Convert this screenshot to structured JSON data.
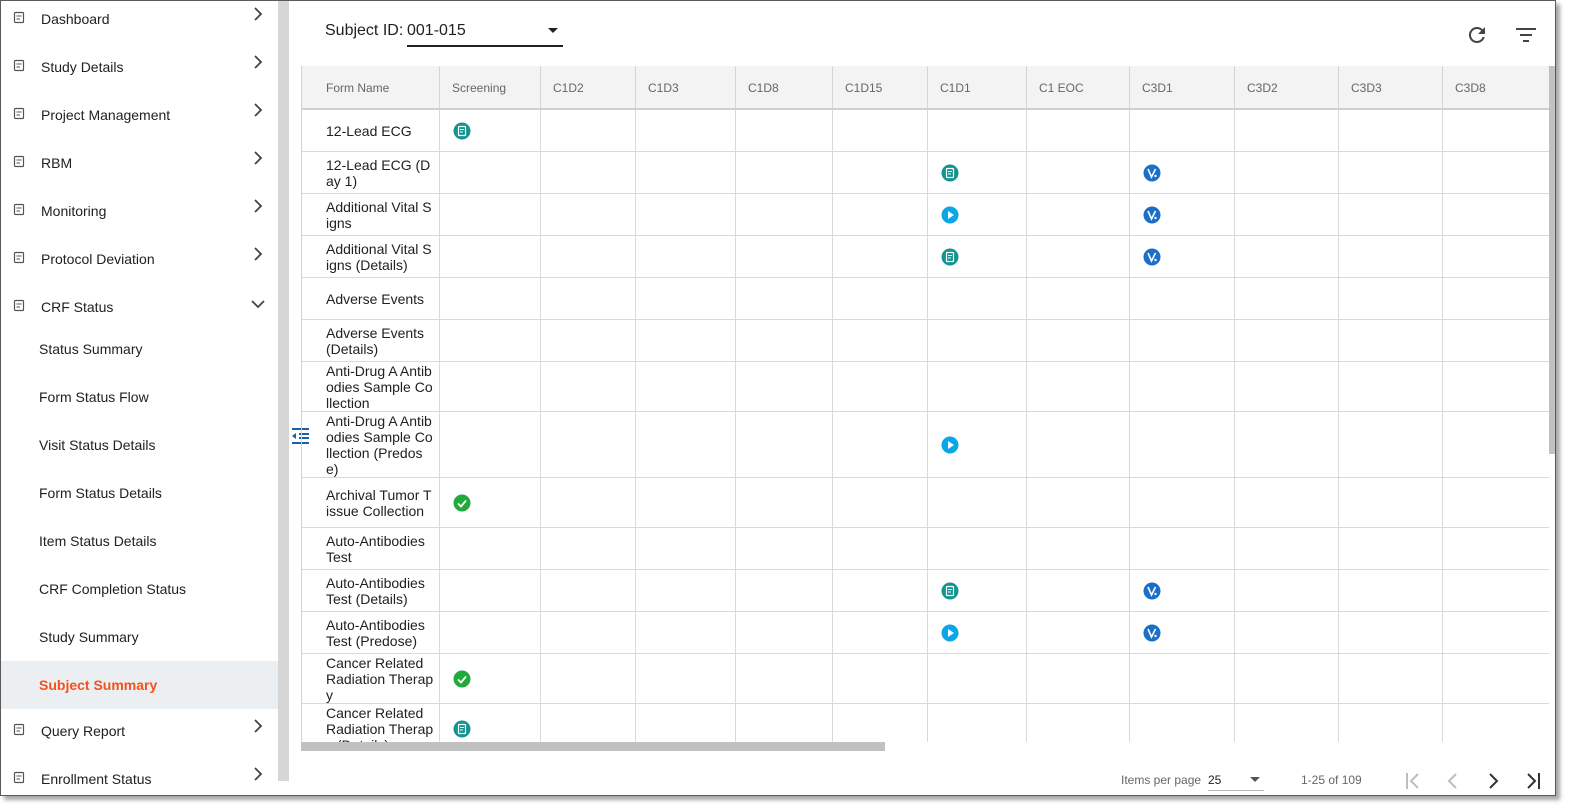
{
  "sidebar": {
    "items": [
      {
        "label": "Dashboard",
        "icon": "dashboard-icon"
      },
      {
        "label": "Study Details",
        "icon": "study-details-icon"
      },
      {
        "label": "Project Management",
        "icon": "project-management-icon"
      },
      {
        "label": "RBM",
        "icon": "rbm-icon"
      },
      {
        "label": "Monitoring",
        "icon": "monitoring-icon"
      },
      {
        "label": "Protocol Deviation",
        "icon": "protocol-deviation-icon"
      },
      {
        "label": "CRF Status",
        "icon": "crf-status-icon"
      }
    ],
    "crf_sub_items": [
      {
        "label": "Status Summary"
      },
      {
        "label": "Form Status Flow"
      },
      {
        "label": "Visit Status Details"
      },
      {
        "label": "Form Status Details"
      },
      {
        "label": "Item Status Details"
      },
      {
        "label": "CRF Completion Status"
      },
      {
        "label": "Study Summary"
      },
      {
        "label": "Subject Summary",
        "active": true
      }
    ],
    "bottom_items": [
      {
        "label": "Query Report",
        "icon": "query-report-icon"
      },
      {
        "label": "Enrollment Status",
        "icon": "enrollment-status-icon"
      }
    ],
    "active_color": "#f4511e"
  },
  "subject": {
    "label": "Subject ID:",
    "value": "001-015"
  },
  "table": {
    "columns": [
      "Form Name",
      "Screening",
      "C1D2",
      "C1D3",
      "C1D8",
      "C1D15",
      "C1D1",
      "C1 EOC",
      "C3D1",
      "C3D2",
      "C3D3",
      "C3D8"
    ],
    "rows": [
      {
        "name": "12-Lead ECG",
        "status": {
          "Screening": "form"
        }
      },
      {
        "name": "12-Lead ECG (Day 1)",
        "status": {
          "C1D1": "form",
          "C3D1": "verified"
        }
      },
      {
        "name": "Additional Vital Signs",
        "status": {
          "C1D1": "play",
          "C3D1": "verified"
        }
      },
      {
        "name": "Additional Vital Signs (Details)",
        "status": {
          "C1D1": "form",
          "C3D1": "verified"
        }
      },
      {
        "name": "Adverse Events",
        "status": {}
      },
      {
        "name": "Adverse Events (Details)",
        "status": {}
      },
      {
        "name": "Anti-Drug A Antibodies Sample Collection",
        "status": {}
      },
      {
        "name": "Anti-Drug A Antibodies Sample Collection (Predose)",
        "status": {
          "C1D1": "play"
        }
      },
      {
        "name": "Archival Tumor Tissue Collection",
        "status": {
          "Screening": "complete"
        }
      },
      {
        "name": "Auto-Antibodies Test",
        "status": {}
      },
      {
        "name": "Auto-Antibodies Test (Details)",
        "status": {
          "C1D1": "form",
          "C3D1": "verified"
        }
      },
      {
        "name": "Auto-Antibodies Test (Predose)",
        "status": {
          "C1D1": "play",
          "C3D1": "verified"
        }
      },
      {
        "name": "Cancer Related Radiation Therapy",
        "status": {
          "Screening": "complete"
        }
      },
      {
        "name": "Cancer Related Radiation Therapy (Details)",
        "status": {
          "Screening": "form"
        }
      }
    ],
    "status_colors": {
      "form": "#13958f",
      "verified": "#1a6fc9",
      "play": "#09a6e8",
      "complete": "#22a93b"
    }
  },
  "paginator": {
    "items_per_page_label": "Items per page",
    "page_size": "25",
    "range": "1-25 of 109"
  }
}
